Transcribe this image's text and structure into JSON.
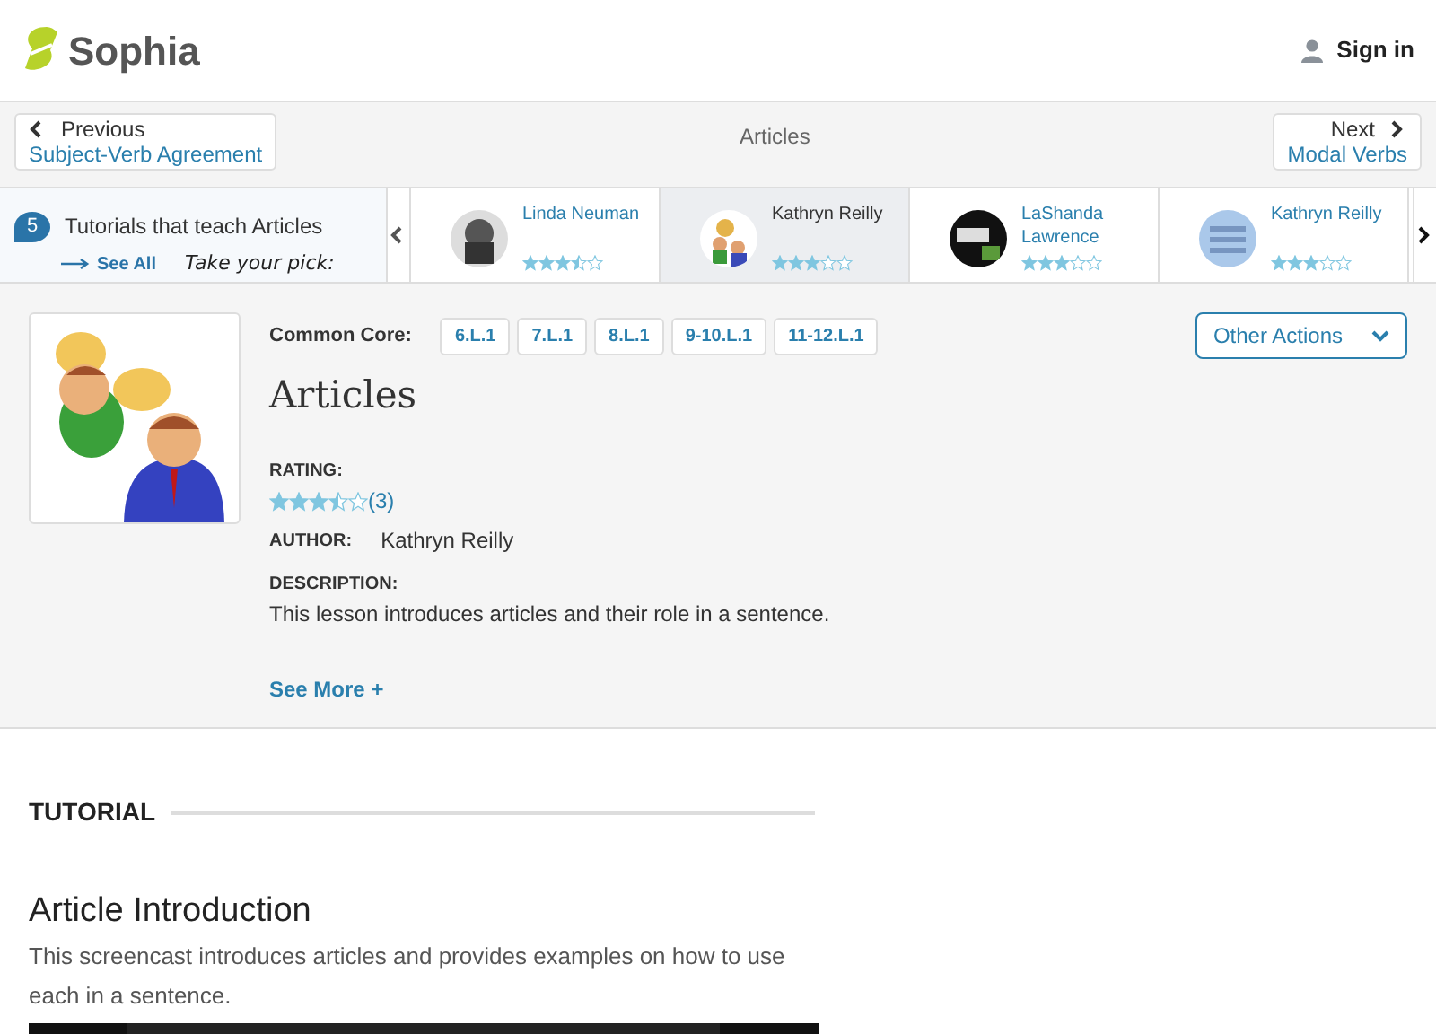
{
  "header": {
    "logo_text": "Sophia",
    "sign_in": "Sign in"
  },
  "lesson_nav": {
    "previous": {
      "label": "Previous",
      "title": "Subject-Verb Agreement"
    },
    "current": "Articles",
    "next": {
      "label": "Next",
      "title": "Modal Verbs"
    }
  },
  "tutorials_strip": {
    "count": "5",
    "heading": "Tutorials that teach Articles",
    "see_all": "See All",
    "tagline": "Take your pick:",
    "items": [
      {
        "author": "Linda Neuman",
        "stars": 3.5,
        "selected": false
      },
      {
        "author": "Kathryn Reilly",
        "stars": 3,
        "selected": true
      },
      {
        "author": "LaShanda Lawrence",
        "stars": 3,
        "selected": false
      },
      {
        "author": "Kathryn Reilly",
        "stars": 3,
        "selected": false
      }
    ]
  },
  "lesson": {
    "common_core_label": "Common Core:",
    "standards": [
      "6.L.1",
      "7.L.1",
      "8.L.1",
      "9-10.L.1",
      "11-12.L.1"
    ],
    "other_actions": "Other Actions",
    "title": "Articles",
    "rating_label": "RATING:",
    "stars": 3.5,
    "rating_count": "(3)",
    "author_label": "AUTHOR:",
    "author": "Kathryn Reilly",
    "description_label": "DESCRIPTION:",
    "description": "This lesson introduces articles and their role in a sentence.",
    "see_more": "See More +"
  },
  "tutorial": {
    "section_label": "TUTORIAL",
    "title": "Article Introduction",
    "description": "This screencast introduces articles and provides examples on how to use each in a sentence."
  }
}
